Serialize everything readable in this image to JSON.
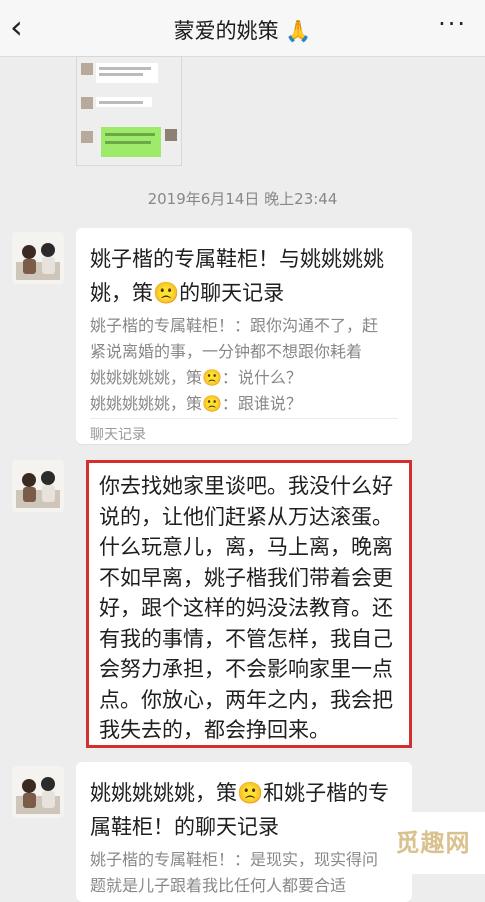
{
  "header": {
    "back_icon": "chevron-left-icon",
    "title": "蒙爱的姚策 🙏",
    "more_label": "···"
  },
  "timestamp": "2019年6月14日 晚上23:44",
  "card1": {
    "title": "姚子楷的专属鞋柜！与姚姚姚姚姚，策🙁的聊天记录",
    "lines": [
      "姚子楷的专属鞋柜！：跟你沟通不了，赶",
      "紧说离婚的事，一分钟都不想跟你耗着",
      "姚姚姚姚姚，策🙁：说什么？",
      "姚姚姚姚姚，策🙁：跟谁说？"
    ],
    "footer": "聊天记录"
  },
  "message": {
    "text": "你去找她家里谈吧。我没什么好说的，让他们赶紧从万达滚蛋。什么玩意儿，离，马上离，晚离不如早离，姚子楷我们带着会更好，跟个这样的妈没法教育。还有我的事情，不管怎样，我自己会努力承担，不会影响家里一点点。你放心，两年之内，我会把我失去的，都会挣回来。"
  },
  "card2": {
    "title": "姚姚姚姚姚，策🙁和姚子楷的专属鞋柜！的聊天记录",
    "lines": [
      "姚子楷的专属鞋柜！：是现实，现实得问",
      "题就是儿子跟着我比任何人都要合适"
    ]
  },
  "watermark": "觅趣网"
}
